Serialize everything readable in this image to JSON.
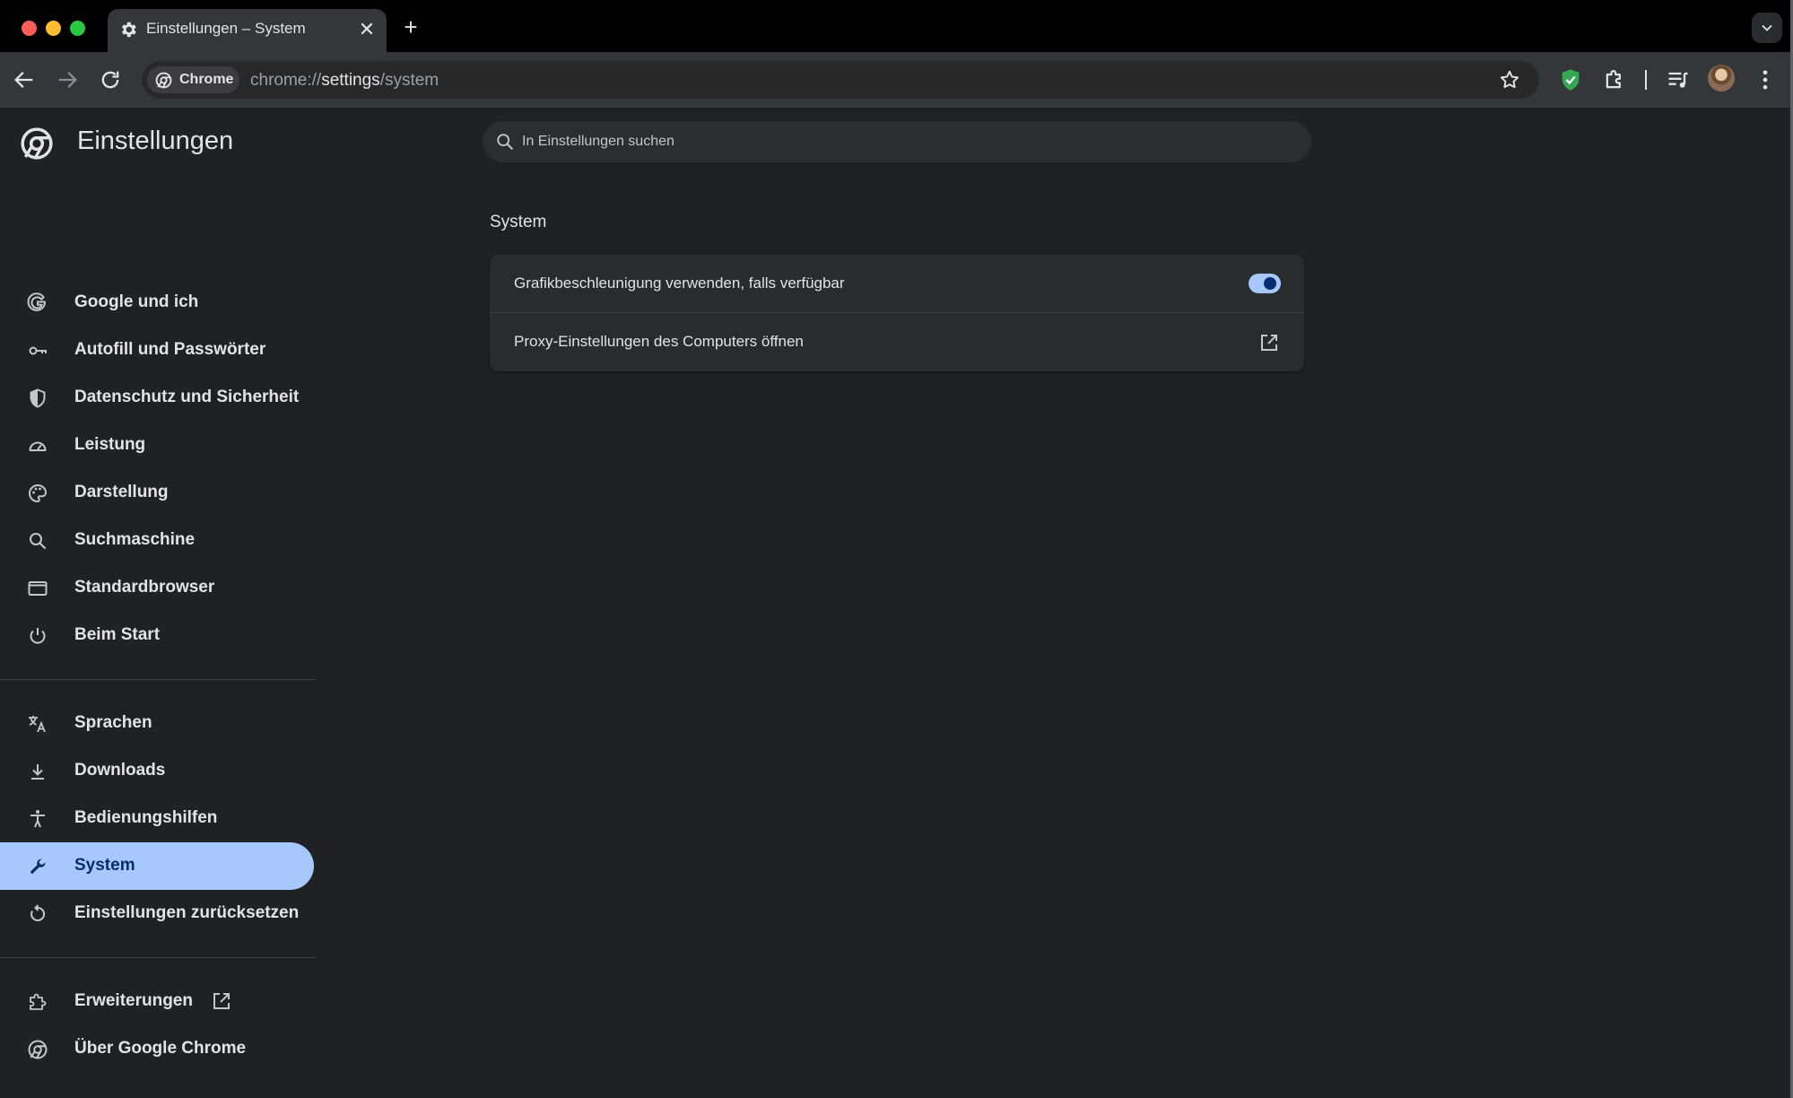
{
  "tab": {
    "title": "Einstellungen – System",
    "close": "✕"
  },
  "newtab": "+",
  "omnibox": {
    "chip": "Chrome",
    "url_scheme": "chrome://",
    "url_host": "settings",
    "url_path": "/system"
  },
  "header": {
    "title": "Einstellungen"
  },
  "search": {
    "placeholder": "In Einstellungen suchen"
  },
  "nav": {
    "group1": [
      {
        "label": "Google und ich",
        "icon": "google-icon"
      },
      {
        "label": "Autofill und Passwörter",
        "icon": "key-icon"
      },
      {
        "label": "Datenschutz und Sicherheit",
        "icon": "shield-icon"
      },
      {
        "label": "Leistung",
        "icon": "speedometer-icon"
      },
      {
        "label": "Darstellung",
        "icon": "palette-icon"
      },
      {
        "label": "Suchmaschine",
        "icon": "search-icon"
      },
      {
        "label": "Standardbrowser",
        "icon": "browser-window-icon"
      },
      {
        "label": "Beim Start",
        "icon": "power-icon"
      }
    ],
    "group2": [
      {
        "label": "Sprachen",
        "icon": "translate-icon"
      },
      {
        "label": "Downloads",
        "icon": "download-icon"
      },
      {
        "label": "Bedienungshilfen",
        "icon": "accessibility-icon"
      },
      {
        "label": "System",
        "icon": "wrench-icon",
        "active": true
      },
      {
        "label": "Einstellungen zurücksetzen",
        "icon": "reset-icon"
      }
    ],
    "group3": [
      {
        "label": "Erweiterungen",
        "icon": "puzzle-icon",
        "external": true
      },
      {
        "label": "Über Google Chrome",
        "icon": "chrome-icon"
      }
    ]
  },
  "main": {
    "section_title": "System",
    "rows": [
      {
        "label": "Grafikbeschleunigung verwenden, falls verfügbar",
        "control": "toggle",
        "on": true
      },
      {
        "label": "Proxy-Einstellungen des Computers öffnen",
        "control": "external-link"
      }
    ]
  },
  "colors": {
    "accent": "#a8c7fa",
    "accent_dark": "#062e6f",
    "background": "#202124",
    "card": "#2a2b2e",
    "shield_green": "#34a853"
  }
}
